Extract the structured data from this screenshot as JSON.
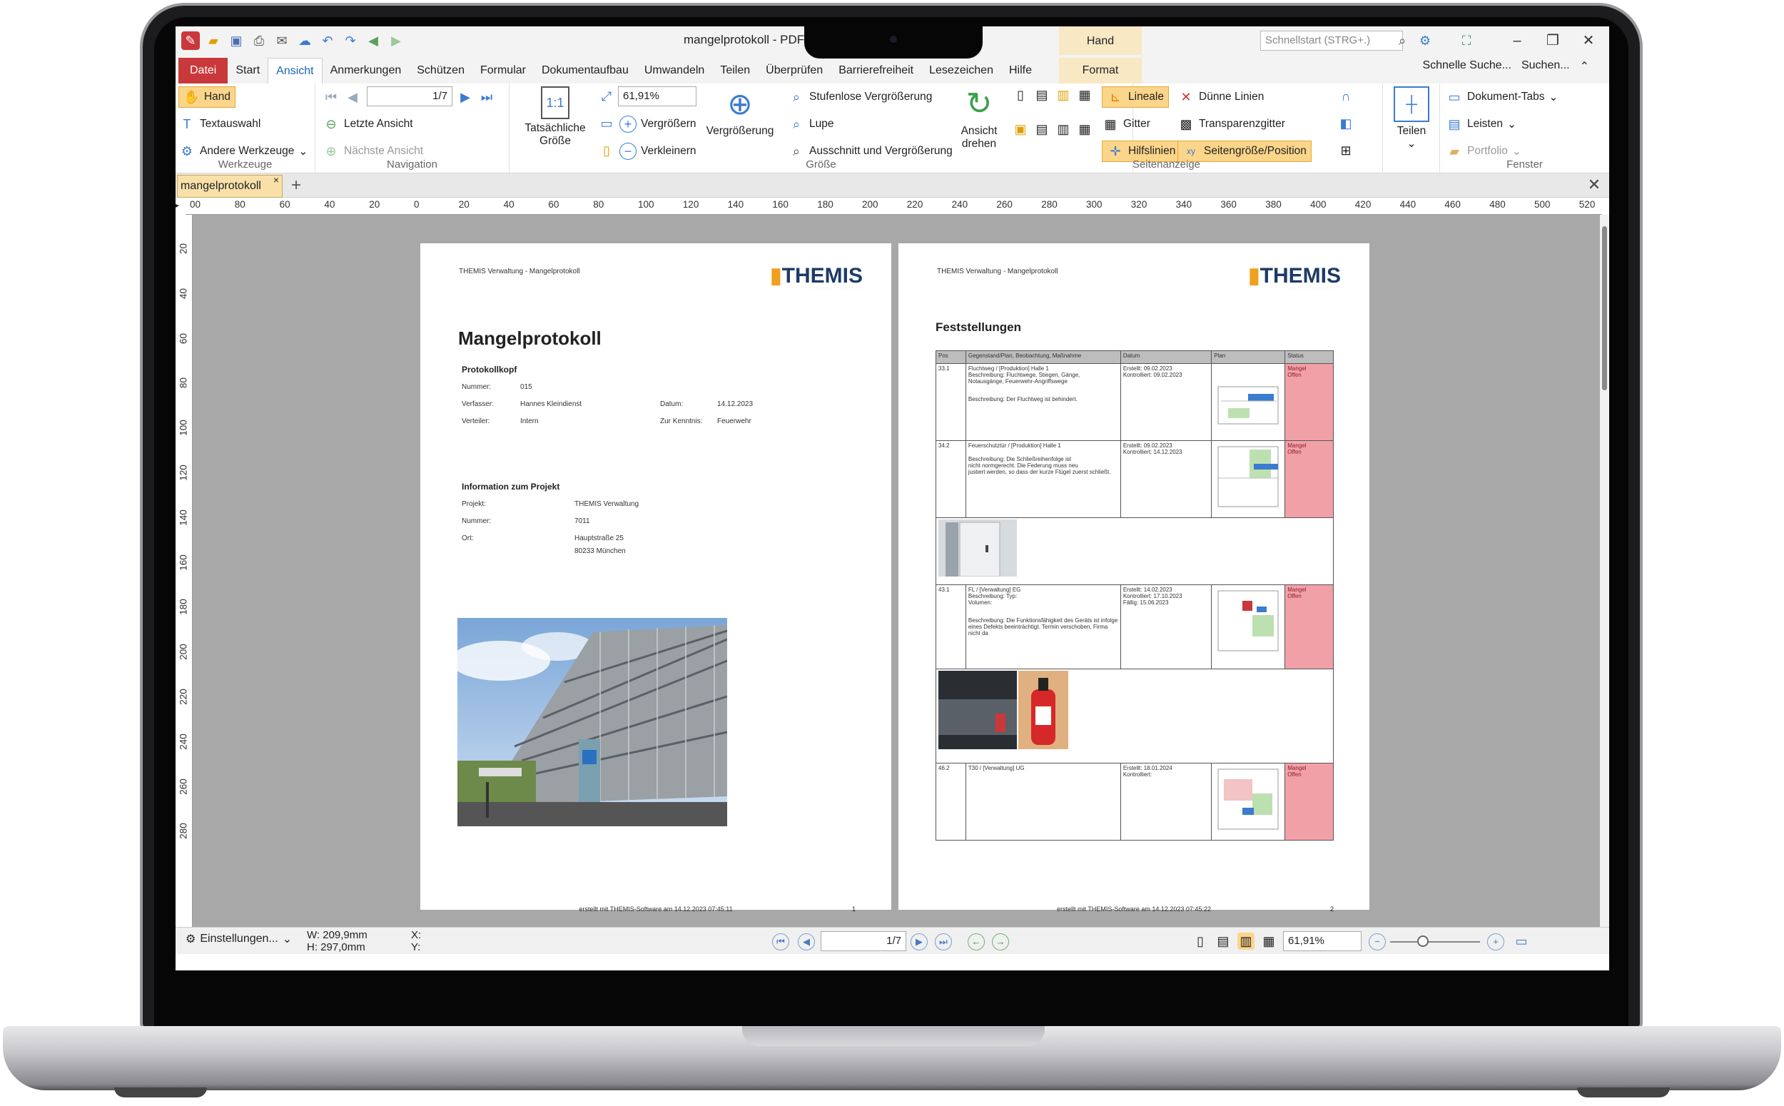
{
  "window": {
    "title": "mangelprotokoll - PDF",
    "context_tab_group": "Hand",
    "quick_search_placeholder": "Schnellstart (STRG+.)",
    "search_links": [
      "Schnelle Suche...",
      "Suchen..."
    ]
  },
  "menu": {
    "items": [
      "Datei",
      "Start",
      "Ansicht",
      "Anmerkungen",
      "Schützen",
      "Formular",
      "Dokumentaufbau",
      "Umwandeln",
      "Teilen",
      "Überprüfen",
      "Barrierefreiheit",
      "Lesezeichen",
      "Hilfe"
    ],
    "active": "Ansicht",
    "context_tab": "Format"
  },
  "ribbon": {
    "werkzeuge": {
      "label": "Werkzeuge",
      "hand": "Hand",
      "text": "Textauswahl",
      "other": "Andere Werkzeuge"
    },
    "navigation": {
      "label": "Navigation",
      "page_value": "1/7",
      "last_view": "Letzte Ansicht",
      "next_view": "Nächste Ansicht"
    },
    "groesse": {
      "label": "Größe",
      "actual_line1": "Tatsächliche",
      "actual_line2": "Größe",
      "zoom_value": "61,91%",
      "zoom_in": "Vergrößern",
      "zoom_out": "Verkleinern",
      "magnify": "Vergrößerung",
      "stepless": "Stufenlose Vergrößerung",
      "loupe": "Lupe",
      "snapshot": "Ausschnitt und Vergrößerung"
    },
    "rotate": {
      "line1": "Ansicht",
      "line2": "drehen"
    },
    "seitenanzeige": {
      "label": "Seitenanzeige",
      "rulers": "Lineale",
      "grid": "Gitter",
      "guides": "Hilfslinien",
      "thin": "Dünne Linien",
      "transparency": "Transparenzgitter",
      "pagesize": "Seitengröße/Position"
    },
    "split": "Teilen",
    "fenster": {
      "label": "Fenster",
      "tabs": "Dokument-Tabs",
      "bars": "Leisten",
      "portfolio": "Portfolio"
    }
  },
  "tab": {
    "name": "mangelprotokoll"
  },
  "rulers": {
    "h": [
      "00",
      "80",
      "60",
      "40",
      "20",
      "0",
      "20",
      "40",
      "60",
      "80",
      "100",
      "120",
      "140",
      "160",
      "180",
      "200",
      "220",
      "240",
      "260",
      "280",
      "300",
      "320",
      "340",
      "360",
      "380",
      "400",
      "420",
      "440",
      "460",
      "480",
      "500",
      "520"
    ],
    "v": [
      "20",
      "40",
      "60",
      "80",
      "100",
      "120",
      "140",
      "160",
      "180",
      "200",
      "220",
      "240",
      "260",
      "280"
    ]
  },
  "page1": {
    "header": "THEMIS Verwaltung - Mangelprotokoll",
    "logo": "THEMIS",
    "title": "Mangelprotokoll",
    "section1": "Protokollkopf",
    "nummer_l": "Nummer:",
    "nummer_v": "015",
    "verfasser_l": "Verfasser:",
    "verfasser_v": "Hannes Kleindienst",
    "datum_l": "Datum:",
    "datum_v": "14.12.2023",
    "verteiler_l": "Verteiler:",
    "verteiler_v": "Intern",
    "kenntnis_l": "Zur Kenntnis:",
    "kenntnis_v": "Feuerwehr",
    "section2": "Information zum Projekt",
    "projekt_l": "Projekt:",
    "projekt_v": "THEMIS Verwaltung",
    "pnummer_l": "Nummer:",
    "pnummer_v": "7011",
    "ort_l": "Ort:",
    "ort_v1": "Hauptstraße 25",
    "ort_v2": "80233 München",
    "footer": "erstellt mit THEMIS-Software am 14.12.2023 07:45:11",
    "num": "1"
  },
  "page2": {
    "header": "THEMIS Verwaltung - Mangelprotokoll",
    "logo": "THEMIS",
    "title": "Feststellungen",
    "cols": [
      "Pos",
      "Gegenstand/Plan, Beobachtung, Maßnahme",
      "Datum",
      "Plan",
      "Status"
    ],
    "rows": [
      {
        "pos": "33.1",
        "l1": "Fluchtweg / [Produktion] Halle 1",
        "l2": "Beschreibung:  Fluchtwege, Stiegen, Gänge,",
        "l3": "Notausgänge, Feuerwehr-Angriffswege",
        "l4": "Beschreibung:   Der Fluchtweg ist behindert.",
        "d1": "Erstellt: 09.02.2023",
        "d2": "Kontrolliert: 09.02.2023",
        "d3": "",
        "s1": "Mangel",
        "s2": "Offen"
      },
      {
        "pos": "34.2",
        "l1": "Feuerschutztür / [Produktion] Halle 1",
        "l2": "Beschreibung:   Die Schließreihenfolge ist",
        "l3": "nicht normgerecht. Die Federung muss neu",
        "l4": "justiert werden, so dass der kurze Flügel zuerst schließt.",
        "d1": "Erstellt: 09.02.2023",
        "d2": "Kontrolliert: 14.12.2023",
        "d3": "",
        "s1": "Mangel",
        "s2": "Offen"
      },
      {
        "pos": "43.1",
        "l1": "FL / [Verwaltung] EG",
        "l2": "Beschreibung:   Typ:",
        "l3": "Volumen:",
        "l4": "Beschreibung:   Die Funktionsfähigkeit des Geräts ist infolge eines Defekts beeinträchtigt. Termin verschoben, Firma nicht da",
        "d1": "Erstellt: 14.02.2023",
        "d2": "Kontrolliert: 17.10.2023",
        "d3": "Fällig: 15.06.2023",
        "s1": "Mangel",
        "s2": "Offen"
      },
      {
        "pos": "46.2",
        "l1": "T30 / [Verwaltung] UG",
        "l2": "",
        "l3": "",
        "l4": "",
        "d1": "Erstellt: 18.01.2024",
        "d2": "Kontrolliert:",
        "d3": "",
        "s1": "Mangel",
        "s2": "Offen"
      }
    ],
    "footer": "erstellt mit THEMIS-Software am 14.12.2023 07:45:22",
    "num": "2"
  },
  "status": {
    "settings": "Einstellungen...",
    "w": "W: 209,9mm",
    "h": "H: 297,0mm",
    "x": "X:",
    "y": "Y:",
    "page_value": "1/7",
    "zoom_value": "61,91%"
  },
  "colors": {
    "accent": "#1e64b4",
    "datei": "#c9383a",
    "highlight": "#fbd58a",
    "status_red": "#f2a0a8"
  }
}
